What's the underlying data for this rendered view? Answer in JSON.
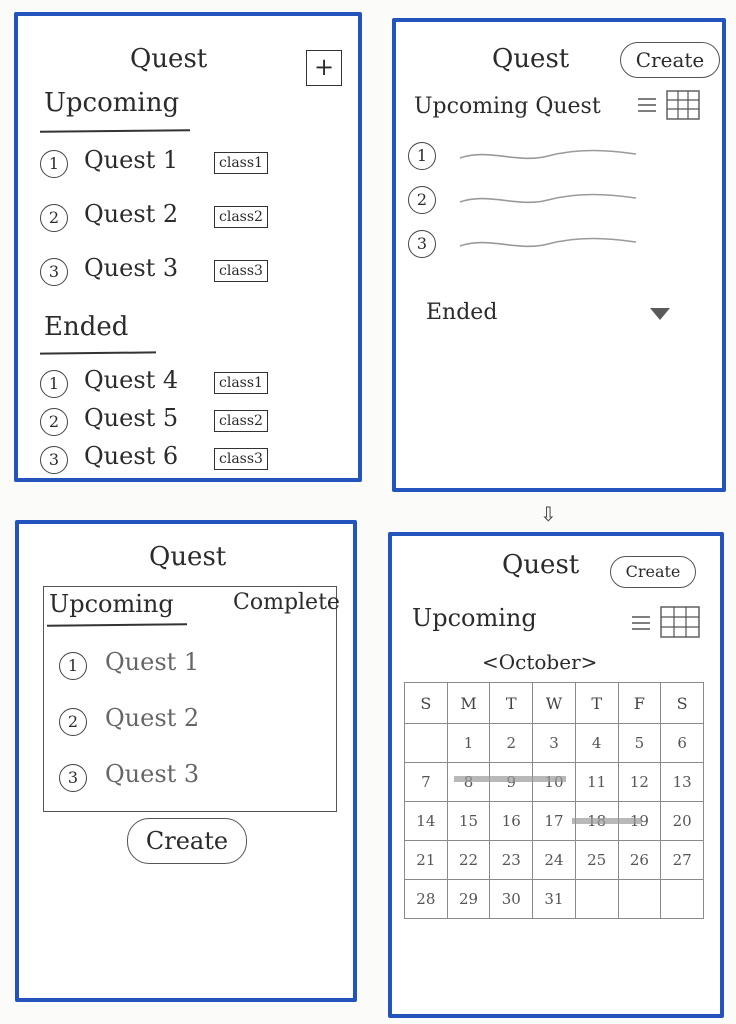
{
  "screen1": {
    "title": "Quest",
    "add_label": "+",
    "upcoming_label": "Upcoming",
    "ended_label": "Ended",
    "upcoming": [
      {
        "num": "1",
        "label": "Quest 1",
        "tag": "class1"
      },
      {
        "num": "2",
        "label": "Quest 2",
        "tag": "class2"
      },
      {
        "num": "3",
        "label": "Quest 3",
        "tag": "class3"
      }
    ],
    "ended": [
      {
        "num": "1",
        "label": "Quest 4",
        "tag": "class1"
      },
      {
        "num": "2",
        "label": "Quest 5",
        "tag": "class2"
      },
      {
        "num": "3",
        "label": "Quest 6",
        "tag": "class3"
      }
    ]
  },
  "screen2": {
    "title": "Quest",
    "create_label": "Create",
    "upcoming_label": "Upcoming Quest",
    "items": [
      "1",
      "2",
      "3"
    ],
    "ended_label": "Ended",
    "list_icon": "list-icon",
    "grid_icon": "grid-icon",
    "dropdown_icon": "triangle-down-icon"
  },
  "screen3": {
    "title": "Quest",
    "tab_upcoming": "Upcoming",
    "tab_complete": "Complete",
    "items": [
      {
        "num": "1",
        "label": "Quest 1"
      },
      {
        "num": "2",
        "label": "Quest 2"
      },
      {
        "num": "3",
        "label": "Quest 3"
      }
    ],
    "create_label": "Create"
  },
  "screen4": {
    "title": "Quest",
    "create_label": "Create",
    "upcoming_label": "Upcoming",
    "month_label": "<October>",
    "weekdays": [
      "S",
      "M",
      "T",
      "W",
      "T",
      "F",
      "S"
    ],
    "weeks": [
      [
        "",
        "1",
        "2",
        "3",
        "4",
        "5",
        "6"
      ],
      [
        "7",
        "8",
        "9",
        "10",
        "11",
        "12",
        "13"
      ],
      [
        "14",
        "15",
        "16",
        "17",
        "18",
        "19",
        "20"
      ],
      [
        "21",
        "22",
        "23",
        "24",
        "25",
        "26",
        "27"
      ],
      [
        "28",
        "29",
        "30",
        "31",
        "",
        "",
        ""
      ]
    ]
  },
  "colors": {
    "frame": "#2354bd",
    "ink": "#2b2b2b",
    "pencil": "#8a8a8a"
  }
}
